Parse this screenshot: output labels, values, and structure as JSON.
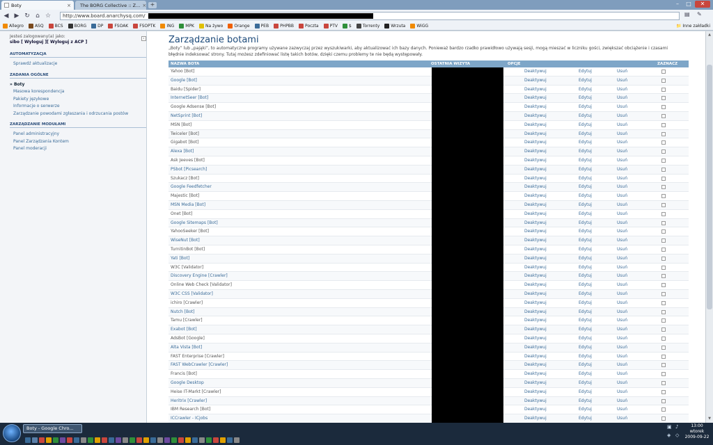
{
  "browser": {
    "tabs": [
      {
        "label": "Boty",
        "active": true
      },
      {
        "label": "The BORG Collective :: Z...",
        "active": false
      }
    ],
    "url": "http://www.board.anarchysq.com/",
    "bookmarks": [
      {
        "label": "Allegro",
        "color": "#f08a00"
      },
      {
        "label": "ASQ",
        "color": "#7a4a1e"
      },
      {
        "label": "BCS",
        "color": "#c9463d"
      },
      {
        "label": "BORG",
        "color": "#333333"
      },
      {
        "label": "DP",
        "color": "#3a6b98"
      },
      {
        "label": "FSOAK",
        "color": "#c9463d"
      },
      {
        "label": "FSOPTK",
        "color": "#c9463d"
      },
      {
        "label": "ING",
        "color": "#f08a00"
      },
      {
        "label": "MPK",
        "color": "#2f8f3a"
      },
      {
        "label": "Na żywo",
        "color": "#e0c000"
      },
      {
        "label": "Orange",
        "color": "#f06000"
      },
      {
        "label": "PEB",
        "color": "#3a6b98"
      },
      {
        "label": "PHPBB",
        "color": "#c9463d"
      },
      {
        "label": "Poczta",
        "color": "#c9463d"
      },
      {
        "label": "PTV",
        "color": "#c9463d"
      },
      {
        "label": "$",
        "color": "#2f8f3a"
      },
      {
        "label": "Torrenty",
        "color": "#444444"
      },
      {
        "label": "Wrzuta",
        "color": "#222222"
      },
      {
        "label": "WiGG",
        "color": "#f08a00"
      }
    ],
    "other_bookmarks": "Inne zakładki"
  },
  "sidebar": {
    "login_text": "Jesteś zalogowany(a) jako:",
    "login_user_line": "sibo [ Wyloguj ][ Wyloguj z ACP ]",
    "sections": [
      {
        "title": "AUTOMATYZACJA",
        "items": [
          "Sprawdź aktualizacje"
        ]
      },
      {
        "title": "ZADANIA OGÓLNE",
        "items": [
          "Boty",
          "Masowa korespondencja",
          "Pakiety językowe",
          "Informacje o serwerze",
          "Zarządzanie powodami zgłaszania i odrzucania postów"
        ]
      },
      {
        "title": "ZARZĄDZANIE MODUŁAMI",
        "items": [
          "Panel administracyjny",
          "Panel Zarządzania Kontem",
          "Panel moderacji"
        ]
      }
    ]
  },
  "main": {
    "title": "Zarządzanie botami",
    "description": "„Boty” lub „pająki”, to automatyczne programy używane zazwyczaj przez wyszukiwarki, aby aktualizować ich bazy danych. Ponieważ bardzo rzadko prawidłowo używają sesji, mogą mieszać w liczniku gości, zwiększać obciążenie i czasami błędnie indeksować strony. Tutaj możesz zdefiniować listę takich botów, dzięki czemu problemy te nie będą występowały.",
    "table": {
      "headers": [
        "NAZWA BOTA",
        "OSTATNIA WIZYTA",
        "OPCJE",
        "ZAZNACZ"
      ],
      "action_labels": {
        "deactivate": "Deaktywuj",
        "edit": "Edytuj",
        "delete": "Usuń"
      },
      "rows": [
        {
          "name": "Yahoo [Bot]",
          "visited": false
        },
        {
          "name": "Google [Bot]",
          "visited": true
        },
        {
          "name": "Baidu [Spider]",
          "visited": false
        },
        {
          "name": "InternetSeer [Bot]",
          "visited": true
        },
        {
          "name": "Google Adsense [Bot]",
          "visited": false
        },
        {
          "name": "NetSprint [Bot]",
          "visited": true
        },
        {
          "name": "MSN [Bot]",
          "visited": false
        },
        {
          "name": "Twiceler [Bot]",
          "visited": false
        },
        {
          "name": "Gigabot [Bot]",
          "visited": false
        },
        {
          "name": "Alexa [Bot]",
          "visited": true
        },
        {
          "name": "Ask Jeeves [Bot]",
          "visited": false
        },
        {
          "name": "PSbot [Picsearch]",
          "visited": true
        },
        {
          "name": "Szukacz [Bot]",
          "visited": false
        },
        {
          "name": "Google Feedfetcher",
          "visited": true
        },
        {
          "name": "Majestic [Bot]",
          "visited": false
        },
        {
          "name": "MSN Media [Bot]",
          "visited": true
        },
        {
          "name": "Onet [Bot]",
          "visited": false
        },
        {
          "name": "Google Sitemaps [Bot]",
          "visited": true
        },
        {
          "name": "YahooSeeker [Bot]",
          "visited": false
        },
        {
          "name": "WiseNut [Bot]",
          "visited": true
        },
        {
          "name": "TurnitinBot [Bot]",
          "visited": false
        },
        {
          "name": "Yati [Bot]",
          "visited": true
        },
        {
          "name": "W3C [Validator]",
          "visited": false
        },
        {
          "name": "Discovery Engine [Crawler]",
          "visited": true
        },
        {
          "name": "Online Web Check [Validator]",
          "visited": false
        },
        {
          "name": "W3C CSS [Validator]",
          "visited": true
        },
        {
          "name": "ichiro [Crawler]",
          "visited": false
        },
        {
          "name": "Nutch [Bot]",
          "visited": true
        },
        {
          "name": "Tamu [Crawler]",
          "visited": false
        },
        {
          "name": "Exabot [Bot]",
          "visited": true
        },
        {
          "name": "AdsBot [Google]",
          "visited": false
        },
        {
          "name": "Alta Vista [Bot]",
          "visited": true
        },
        {
          "name": "FAST Enterprise [Crawler]",
          "visited": false
        },
        {
          "name": "FAST WebCrawler [Crawler]",
          "visited": true
        },
        {
          "name": "Francis [Bot]",
          "visited": false
        },
        {
          "name": "Google Desktop",
          "visited": true
        },
        {
          "name": "Heise IT-Markt [Crawler]",
          "visited": false
        },
        {
          "name": "Heritrix [Crawler]",
          "visited": true
        },
        {
          "name": "IBM Research [Bot]",
          "visited": false
        },
        {
          "name": "ICCrawler - ICjobs",
          "visited": true
        }
      ]
    }
  },
  "taskbar": {
    "active_task": "Boty - Google Chro...",
    "clock_time": "13:00",
    "clock_day": "wtorek",
    "clock_date": "2009-09-22"
  }
}
